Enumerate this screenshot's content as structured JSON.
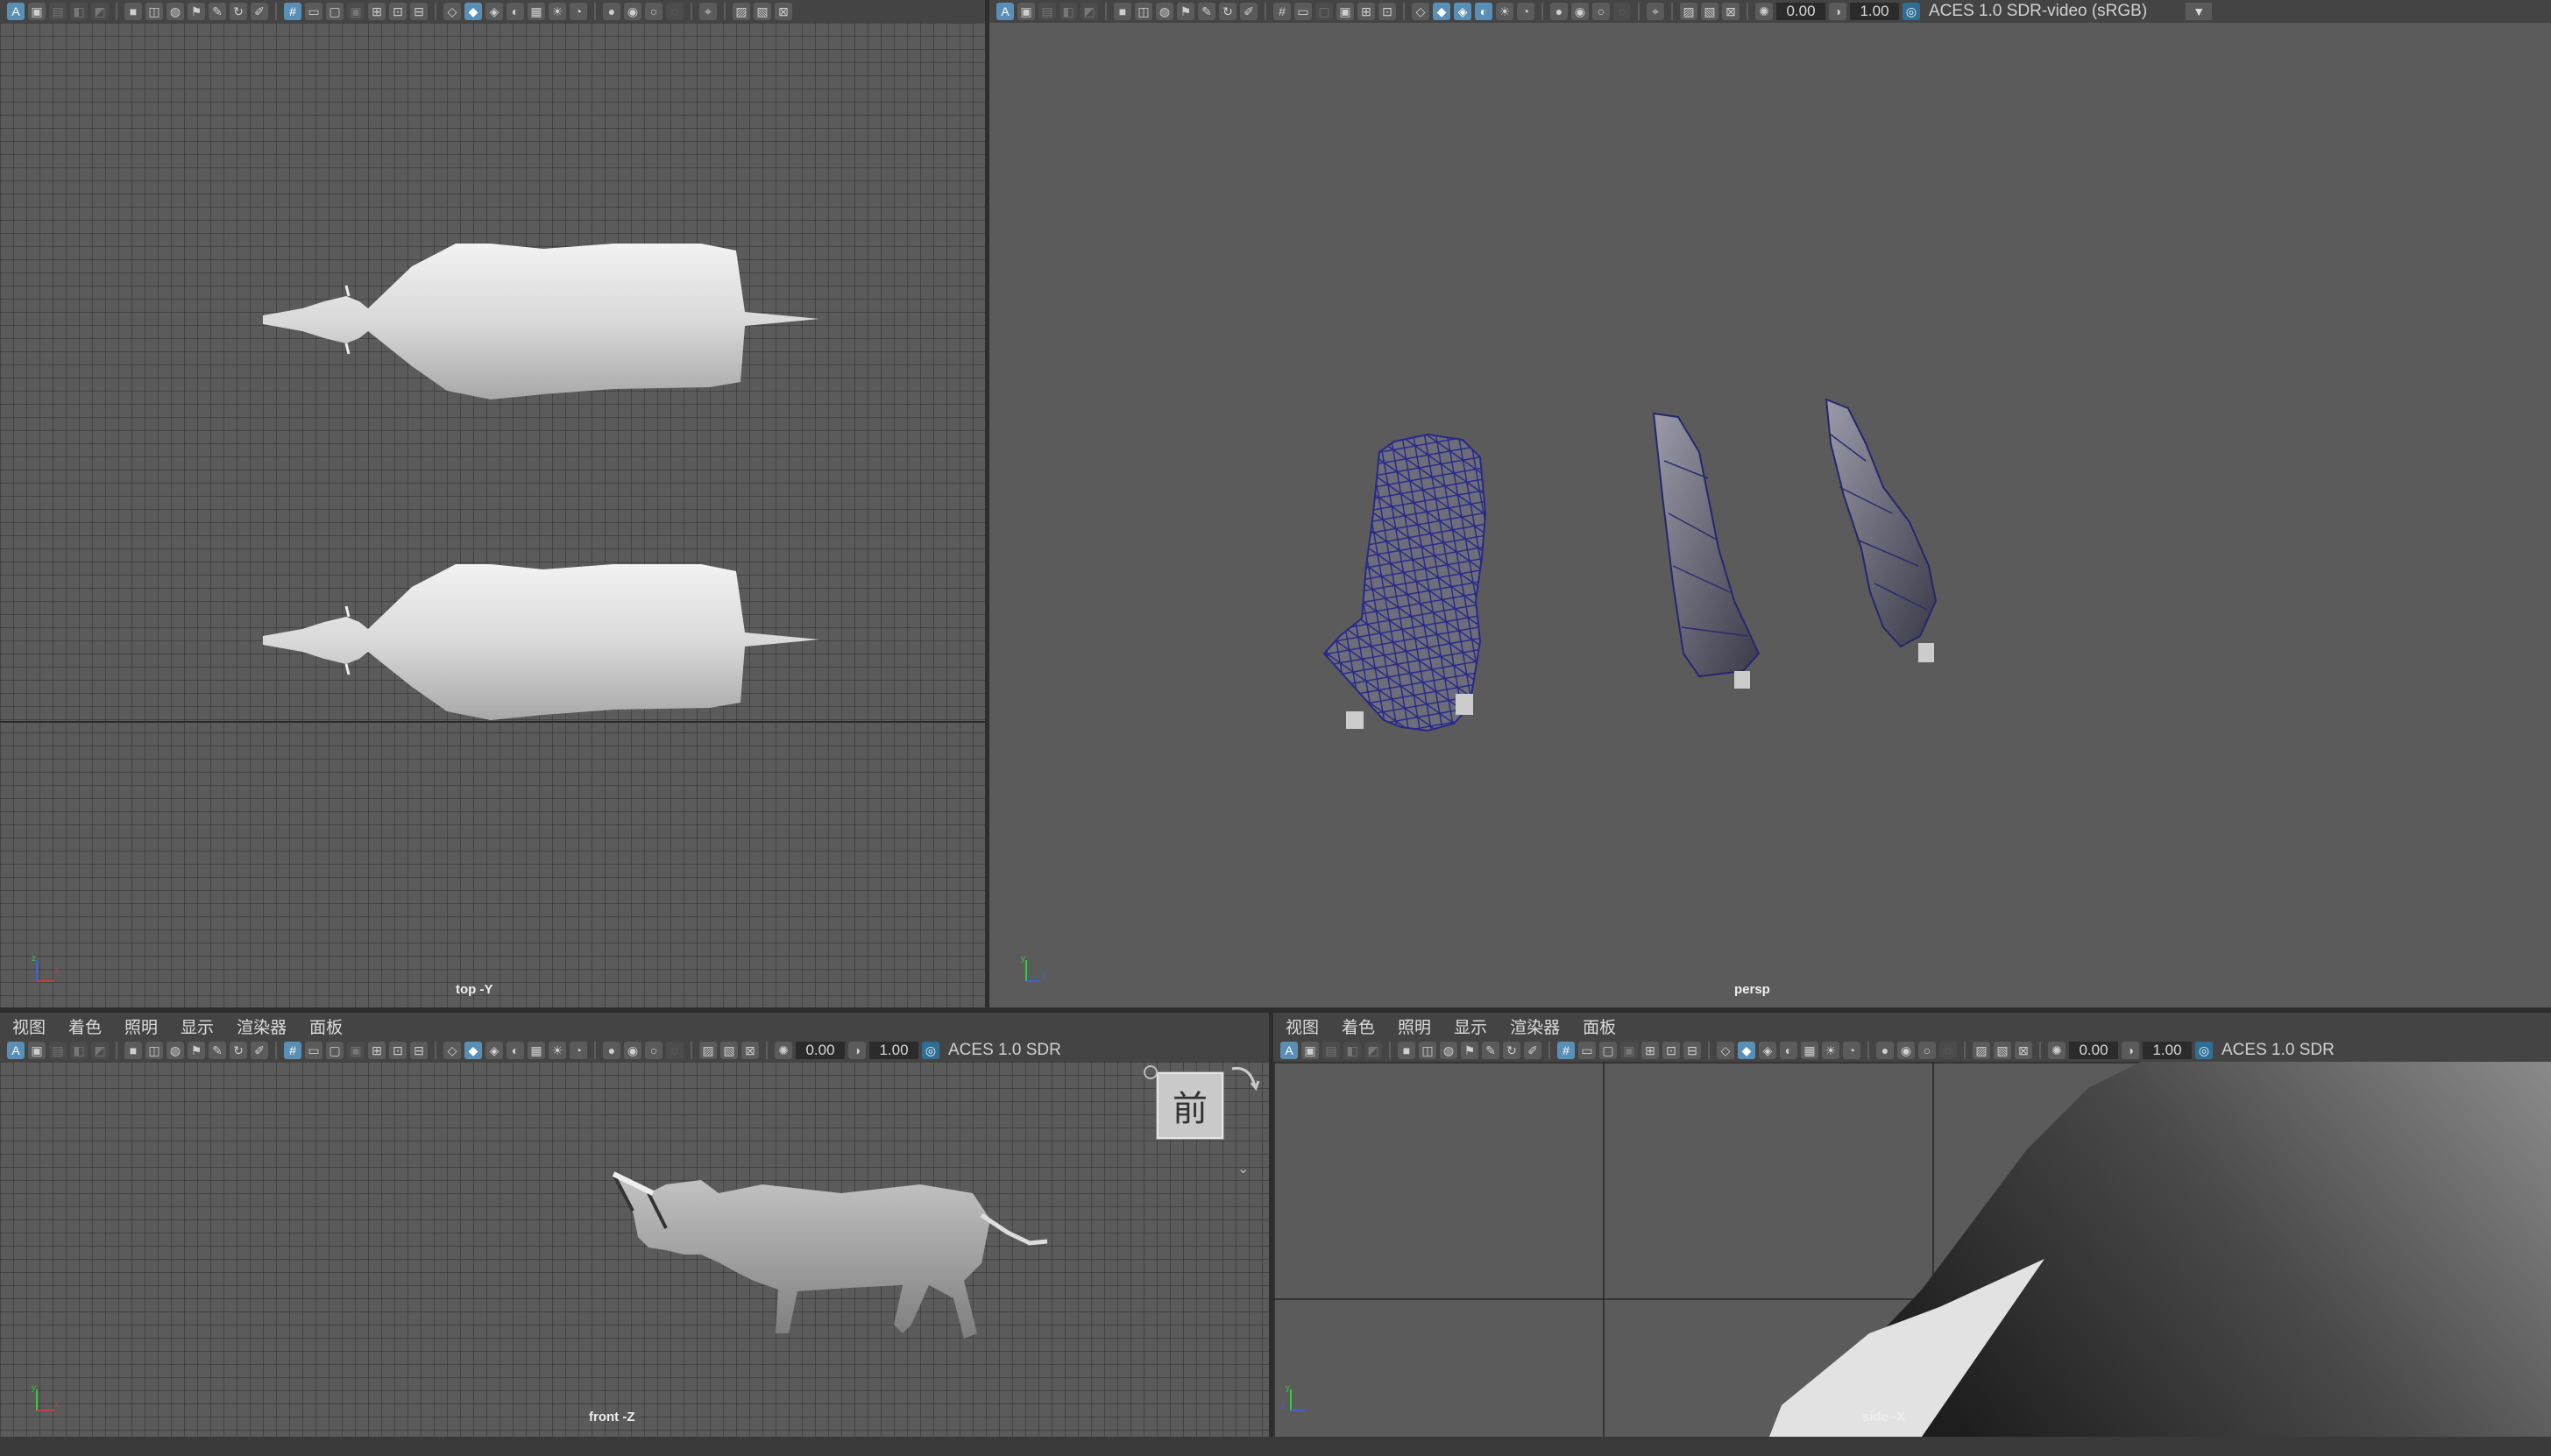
{
  "menu_labels": [
    "视图",
    "着色",
    "照明",
    "显示",
    "渲染器",
    "面板"
  ],
  "toolbar": {
    "exposure_value": "0.00",
    "gamma_value": "1.00",
    "color_space_full": "ACES 1.0 SDR-video (sRGB)",
    "color_space_short": "ACES 1.0 SDR"
  },
  "viewports": {
    "top": {
      "label": "top -Y"
    },
    "persp": {
      "label": "persp"
    },
    "front": {
      "label": "front -Z"
    },
    "side": {
      "label": "side -X"
    }
  },
  "viewcube": {
    "face_label": "前"
  },
  "colors": {
    "panel_bg": "#444444",
    "viewport_bg": "#5b5b5b",
    "wireframe": "#2a2a8c",
    "active_icon": "#5a8fb5",
    "axis_x": "#d23a3a",
    "axis_y": "#3ac84a",
    "axis_z": "#3a64d8"
  },
  "icons": {
    "select_camera": "camera-icon",
    "wireframe": "wireframe-icon",
    "shaded": "shaded-cube-icon",
    "lights": "light-bulb-icon",
    "grid": "grid-icon",
    "xray": "xray-icon",
    "exposure": "exposure-icon",
    "gamma": "gamma-icon",
    "color_mgmt": "color-management-icon",
    "dropdown": "chevron-down-icon"
  }
}
